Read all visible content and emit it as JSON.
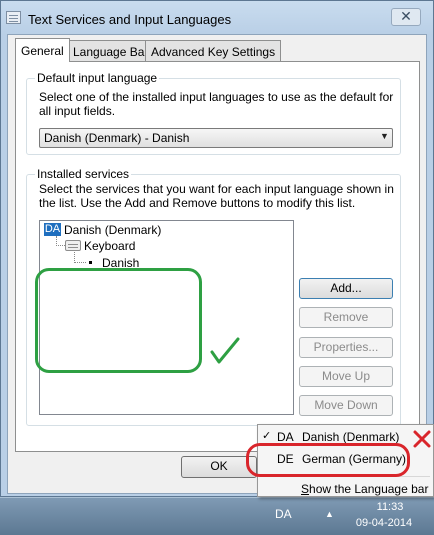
{
  "window": {
    "title": "Text Services and Input Languages",
    "close_glyph": "✕"
  },
  "tabs": [
    {
      "label": "General",
      "active": true
    },
    {
      "label": "Language Bar",
      "active": false
    },
    {
      "label": "Advanced Key Settings",
      "active": false
    }
  ],
  "default_input": {
    "legend": "Default input language",
    "description": "Select one of the installed input languages to use as the default for all input fields.",
    "selected": "Danish (Denmark) - Danish"
  },
  "installed_services": {
    "legend": "Installed services",
    "description": "Select the services that you want for each input language shown in the list. Use the Add and Remove buttons to modify this list.",
    "tree": {
      "language_code": "DA",
      "language": "Danish (Denmark)",
      "category": "Keyboard",
      "layout": "Danish"
    },
    "buttons": {
      "add": "Add...",
      "remove": "Remove",
      "properties": "Properties...",
      "move_up": "Move Up",
      "move_down": "Move Down"
    }
  },
  "footer": {
    "ok_label": "OK"
  },
  "context_menu": {
    "check_glyph": "✓",
    "items": [
      {
        "code": "DA",
        "name": "Danish (Denmark)",
        "checked": true
      },
      {
        "code": "DE",
        "name": "German (Germany)",
        "checked": false
      }
    ],
    "show_language_bar": "Show the Language bar"
  },
  "taskbar": {
    "language": "DA",
    "tray_arrow": "▲",
    "time": "11:33",
    "date": "09-04-2014"
  },
  "colors": {
    "annotation_green": "#2ea043",
    "annotation_red": "#d9252b",
    "selection_blue": "#1f6fbf"
  }
}
